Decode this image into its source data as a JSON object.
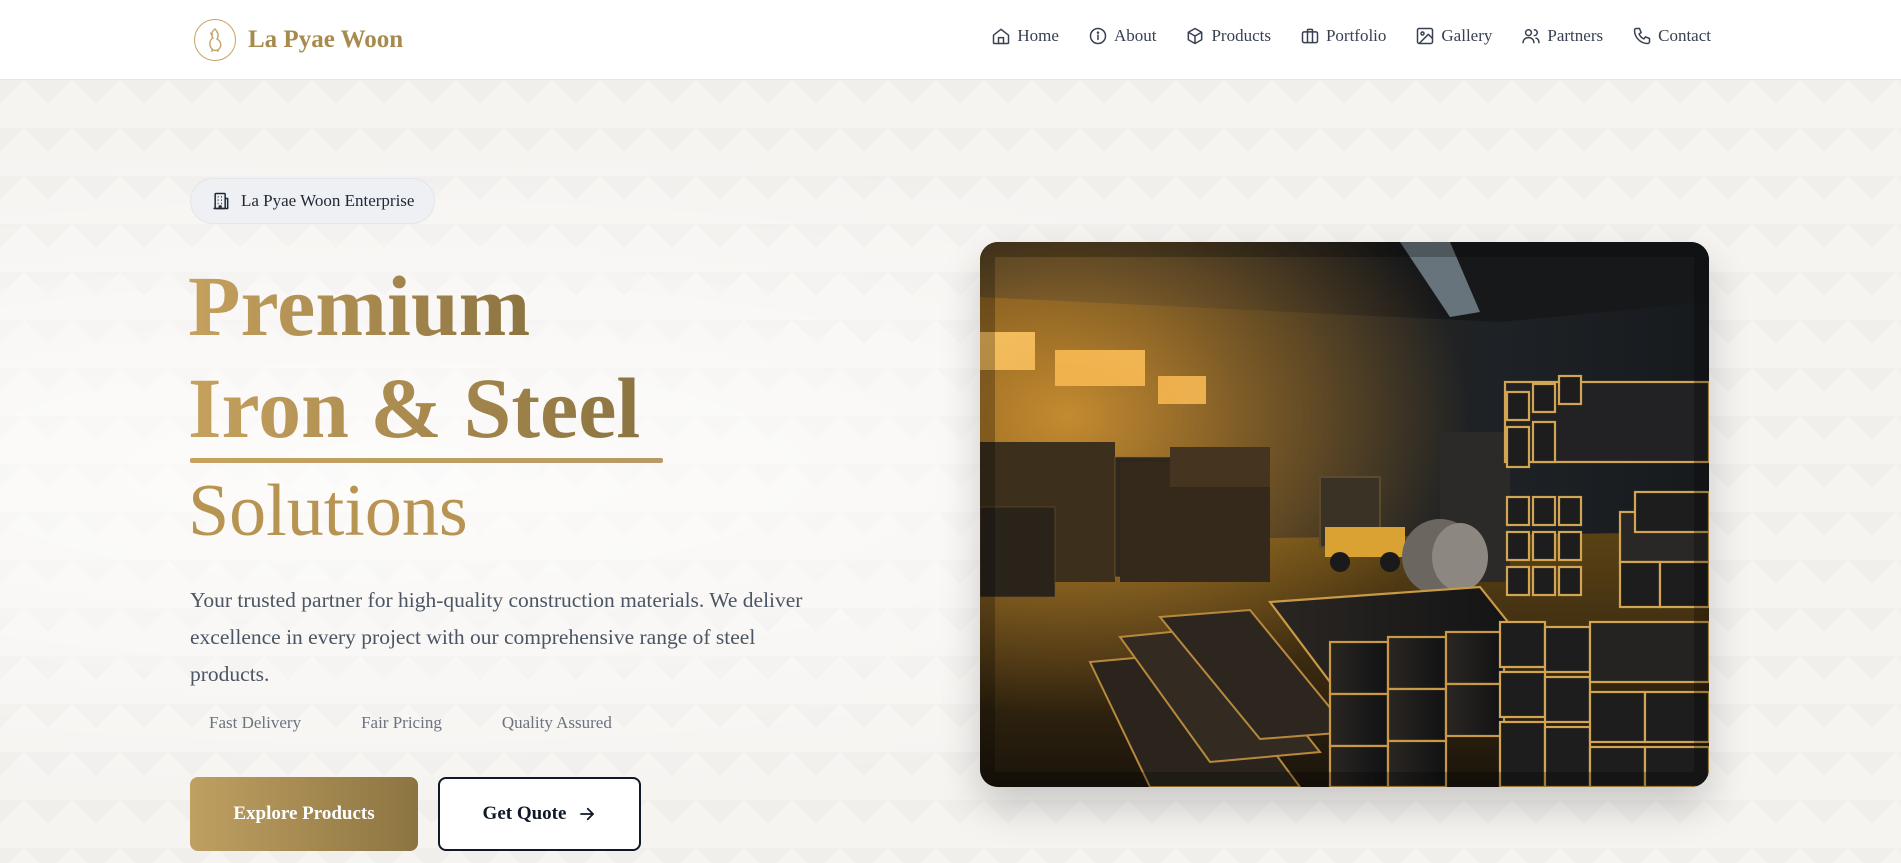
{
  "header": {
    "brand_name": "La Pyae Woon",
    "nav": [
      {
        "label": "Home",
        "icon": "home-icon"
      },
      {
        "label": "About",
        "icon": "info-icon"
      },
      {
        "label": "Products",
        "icon": "package-icon"
      },
      {
        "label": "Portfolio",
        "icon": "briefcase-icon"
      },
      {
        "label": "Gallery",
        "icon": "image-icon"
      },
      {
        "label": "Partners",
        "icon": "users-icon"
      },
      {
        "label": "Contact",
        "icon": "phone-icon"
      }
    ]
  },
  "hero": {
    "badge_label": "La Pyae Woon Enterprise",
    "title_line1": "Premium",
    "title_line2": "Iron & Steel",
    "title_line3": "Solutions",
    "description": "Your trusted partner for high-quality construction materials. We deliver excellence in every project with our comprehensive range of steel products.",
    "features": [
      "Fast Delivery",
      "Fair Pricing",
      "Quality Assured"
    ],
    "primary_button": "Explore Products",
    "secondary_button": "Get Quote"
  },
  "colors": {
    "accent_gold": "#bfa062",
    "accent_gold_dark": "#8c7441",
    "text_dark": "#111827",
    "text_muted": "#4b5563"
  }
}
